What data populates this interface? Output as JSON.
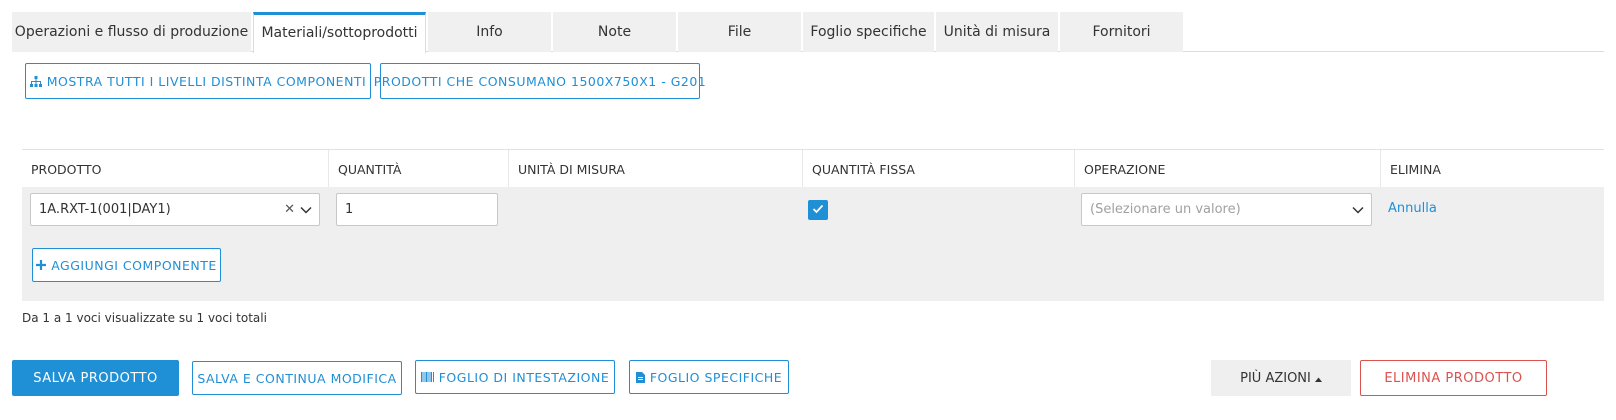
{
  "tabs": [
    {
      "label": "Operazioni e flusso di produzione"
    },
    {
      "label": "Materiali/sottoprodotti"
    },
    {
      "label": "Info"
    },
    {
      "label": "Note"
    },
    {
      "label": "File"
    },
    {
      "label": "Foglio specifiche"
    },
    {
      "label": "Unità di misura"
    },
    {
      "label": "Fornitori"
    }
  ],
  "active_tab": "Materiali/sottoprodotti",
  "toolbar": {
    "show_levels_label": "MOSTRA TUTTI I LIVELLI DISTINTA COMPONENTI",
    "consumers_label": "PRODOTTI CHE CONSUMANO 1500X750X1 - G201"
  },
  "table": {
    "headers": {
      "product": "PRODOTTO",
      "quantity": "QUANTITÀ",
      "unit": "UNITÀ DI MISURA",
      "fixed_quantity": "QUANTITÀ FISSA",
      "operation": "OPERAZIONE",
      "delete": "ELIMINA"
    },
    "rows": [
      {
        "product": "1A.RXT-1(001|DAY1)",
        "quantity": "1",
        "unit": "",
        "fixed_quantity": true,
        "operation_placeholder": "(Selezionare un valore)",
        "delete_label": "Annulla"
      }
    ],
    "add_component_label": "AGGIUNGI COMPONENTE",
    "info_text": "Da 1 a 1 voci visualizzate su 1 voci totali"
  },
  "footer": {
    "save_label": "SALVA PRODOTTO",
    "save_continue_label": "SALVA E CONTINUA MODIFICA",
    "header_sheet_label": "FOGLIO DI INTESTAZIONE",
    "spec_sheet_label": "FOGLIO SPECIFICHE",
    "more_actions_label": "PIÙ AZIONI",
    "delete_product_label": "ELIMINA PRODOTTO"
  },
  "colors": {
    "accent": "#1f8fd6",
    "danger": "#d9534f",
    "tab_bg": "#f0f0f0",
    "row_bg": "#efefef"
  },
  "icons": {
    "show_levels": "sitemap-icon",
    "add_component": "plus-icon",
    "header_sheet": "barcode-icon",
    "spec_sheet": "document-icon",
    "more_actions": "caret-up-icon",
    "clear": "clear-x-icon",
    "dropdown": "chevron-down-icon",
    "checkbox": "check-icon"
  }
}
